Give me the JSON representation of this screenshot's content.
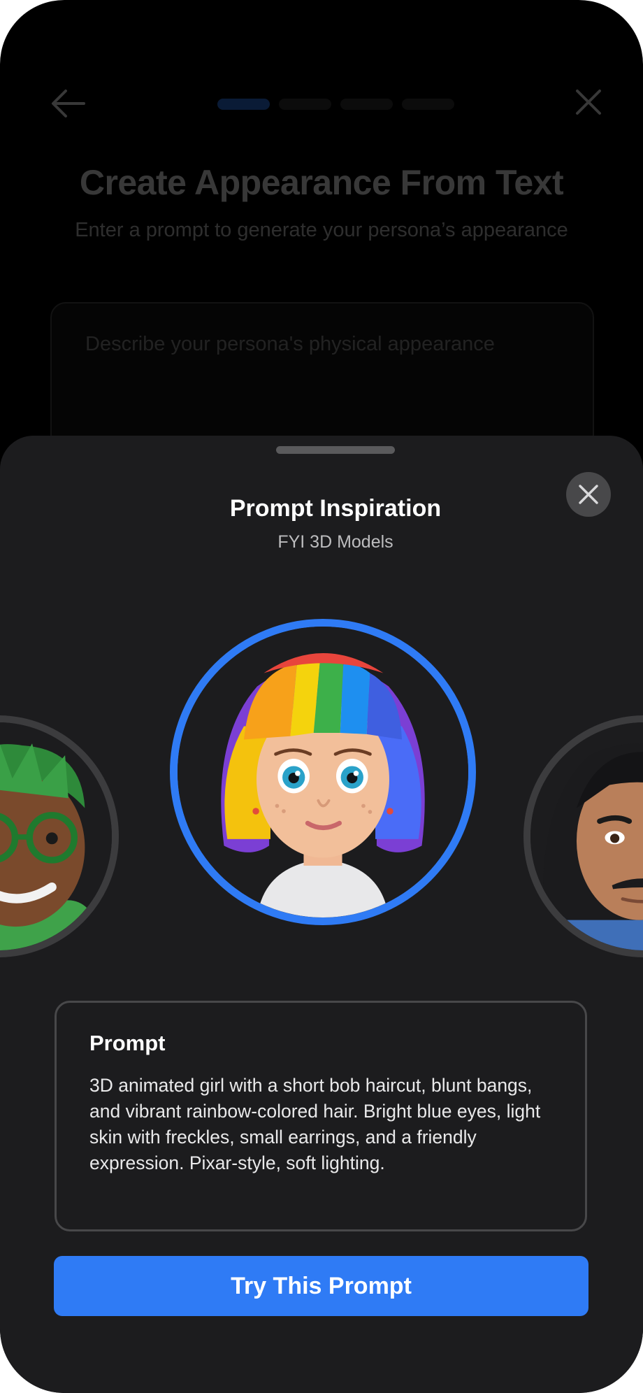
{
  "background_page": {
    "title": "Create Appearance From Text",
    "subtitle": "Enter a prompt to generate your persona’s appearance",
    "textarea_placeholder": "Describe your persona's physical appearance",
    "progress": {
      "total_steps": 4,
      "current_step": 1
    },
    "icons": {
      "back": "arrow-left-icon",
      "close": "close-icon"
    }
  },
  "sheet": {
    "title": "Prompt Inspiration",
    "subtitle": "FYI 3D Models",
    "close_icon": "close-icon",
    "avatars": [
      {
        "id": "left",
        "description": "green-hair-boy-avatar"
      },
      {
        "id": "center",
        "description": "rainbow-bob-girl-avatar",
        "selected": true
      },
      {
        "id": "right",
        "description": "long-black-hair-man-avatar"
      }
    ],
    "prompt": {
      "heading": "Prompt",
      "text": "3D animated girl with a short bob haircut, blunt bangs, and vibrant rainbow-colored hair. Bright blue eyes, light skin with freckles, small earrings, and a friendly expression. Pixar-style, soft lighting."
    },
    "cta_label": "Try This Prompt"
  },
  "colors": {
    "accent": "#2f7bf5",
    "sheet_bg": "#1c1c1e",
    "page_bg": "#000000"
  }
}
